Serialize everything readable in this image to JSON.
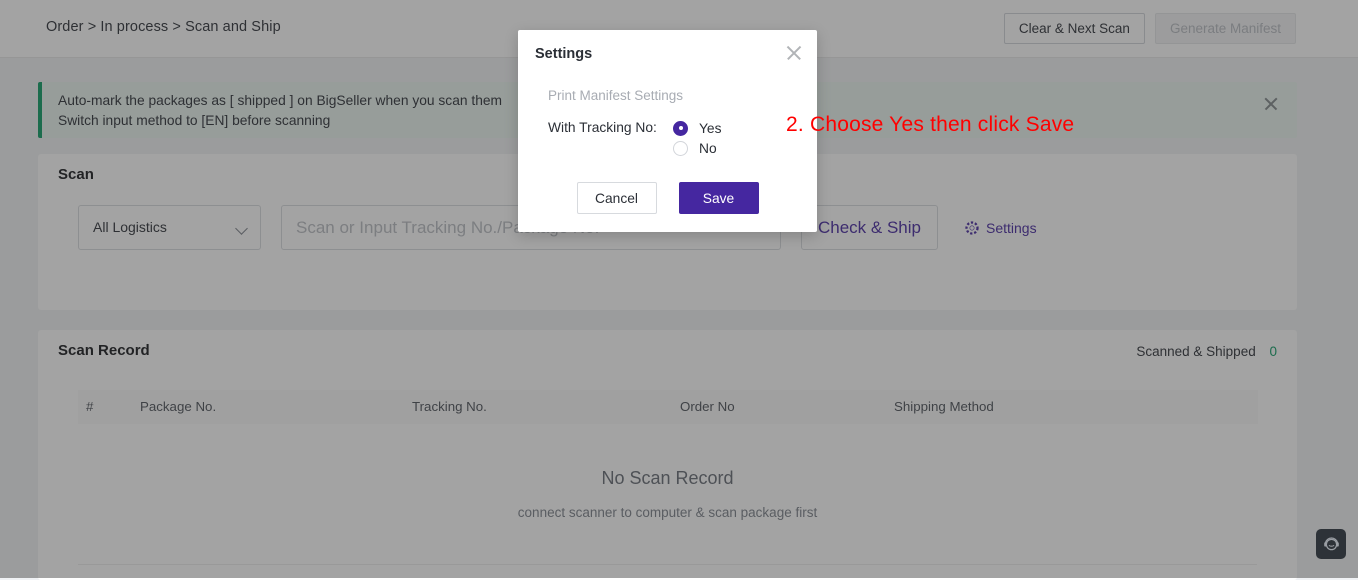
{
  "topbar": {
    "breadcrumb": "Order > In process > Scan and Ship",
    "clear_next_scan_label": "Clear & Next Scan",
    "generate_manifest_label": "Generate Manifest"
  },
  "alert": {
    "text": "Auto-mark the packages as [ shipped ] on BigSeller when you scan them\nSwitch input method to [EN] before scanning",
    "close_icon": "close-icon",
    "accent_color": "#0a9c63"
  },
  "scan": {
    "title": "Scan",
    "logistics_selected": "All Logistics",
    "input_placeholder": "Scan or Input Tracking No./Package No.",
    "input_value": "",
    "check_ship_label": "Check & Ship",
    "settings_label": "Settings",
    "settings_icon": "gear-icon",
    "accent_color": "#4527a0"
  },
  "scan_record": {
    "title": "Scan Record",
    "counter_label": "Scanned & Shipped",
    "counter_value": "0",
    "counter_color": "#0a9c63",
    "columns": [
      "#",
      "Package No.",
      "Tracking No.",
      "Order No",
      "Shipping Method"
    ],
    "rows": [],
    "empty_title": "No Scan Record",
    "empty_subtitle": "connect scanner to computer & scan package first"
  },
  "modal": {
    "title": "Settings",
    "close_icon": "close-icon",
    "section_label": "Print Manifest Settings",
    "field_label": "With Tracking No:",
    "options": [
      {
        "label": "Yes",
        "checked": true
      },
      {
        "label": "No",
        "checked": false
      }
    ],
    "cancel_label": "Cancel",
    "save_label": "Save",
    "save_color": "#4527a0"
  },
  "annotation": {
    "text": "2. Choose Yes then click Save",
    "color": "#ff0000"
  },
  "support": {
    "icon": "headset-icon"
  }
}
